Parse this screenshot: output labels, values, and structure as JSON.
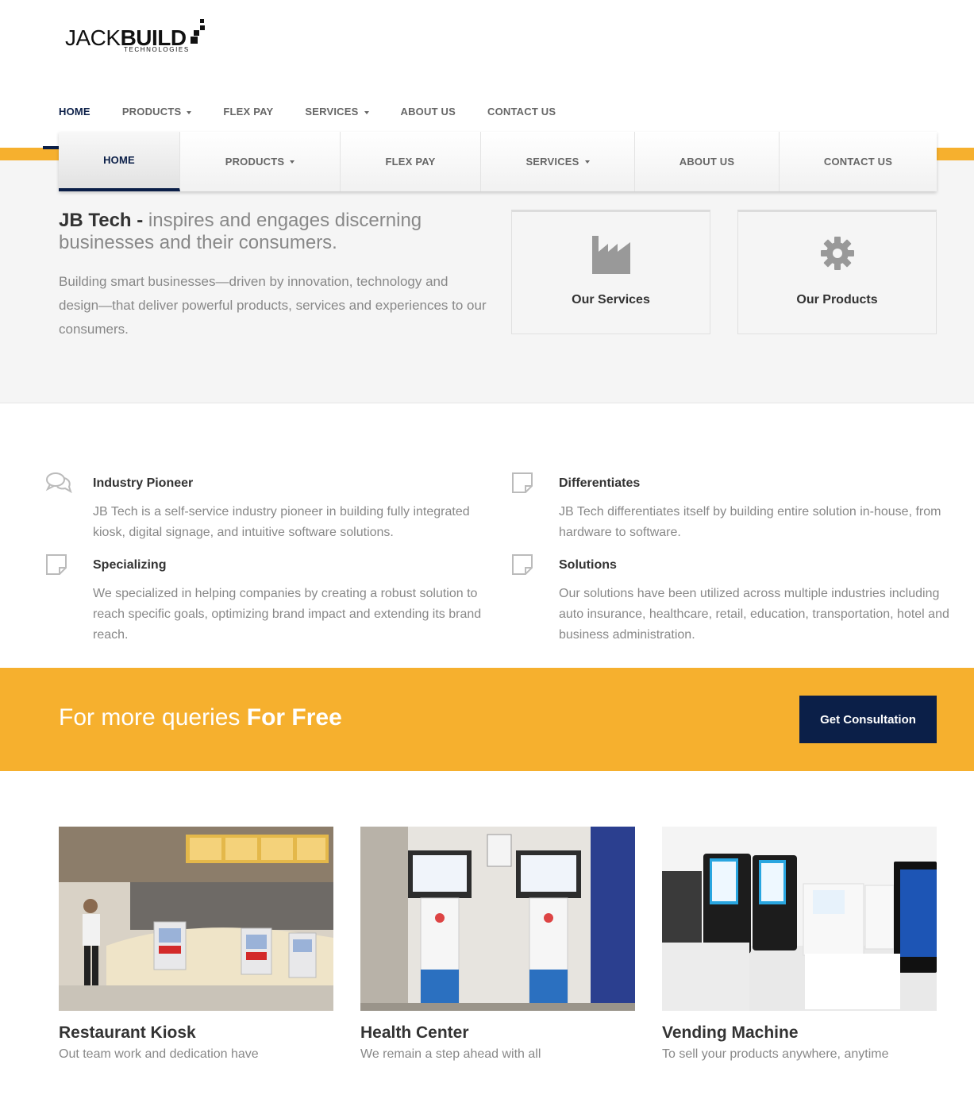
{
  "logo": {
    "main_light": "JACK",
    "main_bold": "BUILD",
    "sub": "TECHNOLOGIES"
  },
  "top_nav": [
    {
      "label": "HOME",
      "dropdown": false
    },
    {
      "label": "PRODUCTS",
      "dropdown": true
    },
    {
      "label": "FLEX PAY",
      "dropdown": false
    },
    {
      "label": "SERVICES",
      "dropdown": true
    },
    {
      "label": "ABOUT US",
      "dropdown": false
    },
    {
      "label": "CONTACT US",
      "dropdown": false
    }
  ],
  "main_nav": [
    {
      "label": "HOME",
      "dropdown": false
    },
    {
      "label": "PRODUCTS",
      "dropdown": true
    },
    {
      "label": "FLEX PAY",
      "dropdown": false
    },
    {
      "label": "SERVICES",
      "dropdown": true
    },
    {
      "label": "ABOUT US",
      "dropdown": false
    },
    {
      "label": "CONTACT US",
      "dropdown": false
    }
  ],
  "hero": {
    "brand": "JB Tech -",
    "tagline": " inspires and engages discerning businesses and their consumers.",
    "text": "Building smart businesses—driven by innovation, technology and design—that deliver powerful products, services and experiences to our consumers."
  },
  "cards": [
    {
      "label": "Our Services",
      "icon": "factory-icon"
    },
    {
      "label": "Our Products",
      "icon": "gear-icon"
    }
  ],
  "features": [
    {
      "title": "Industry Pioneer",
      "text": "JB Tech is a self-service industry pioneer in building fully integrated kiosk, digital signage, and intuitive software solutions.",
      "icon": "comments-icon"
    },
    {
      "title": "Differentiates",
      "text": "JB Tech differentiates itself by building entire solution in-house, from hardware to software.",
      "icon": "note-icon"
    },
    {
      "title": "Specializing",
      "text": "We specialized in helping companies by creating a robust solution to reach specific goals, optimizing brand impact and extending its brand reach.",
      "icon": "note-icon"
    },
    {
      "title": "Solutions",
      "text": "Our solutions have been utilized across multiple industries including auto insurance, healthcare, retail, education, transportation, hotel and business administration.",
      "icon": "note-icon"
    }
  ],
  "cta": {
    "text_light": "For more queries ",
    "text_bold": "For Free",
    "button": "Get Consultation"
  },
  "products": [
    {
      "title": "Restaurant Kiosk",
      "text": "Out team work and dedication have"
    },
    {
      "title": "Health Center",
      "text": "We remain a step ahead with all"
    },
    {
      "title": "Vending Machine",
      "text": "To sell your products anywhere, anytime"
    }
  ],
  "colors": {
    "accent": "#f6b02e",
    "navy": "#0b1f48"
  }
}
